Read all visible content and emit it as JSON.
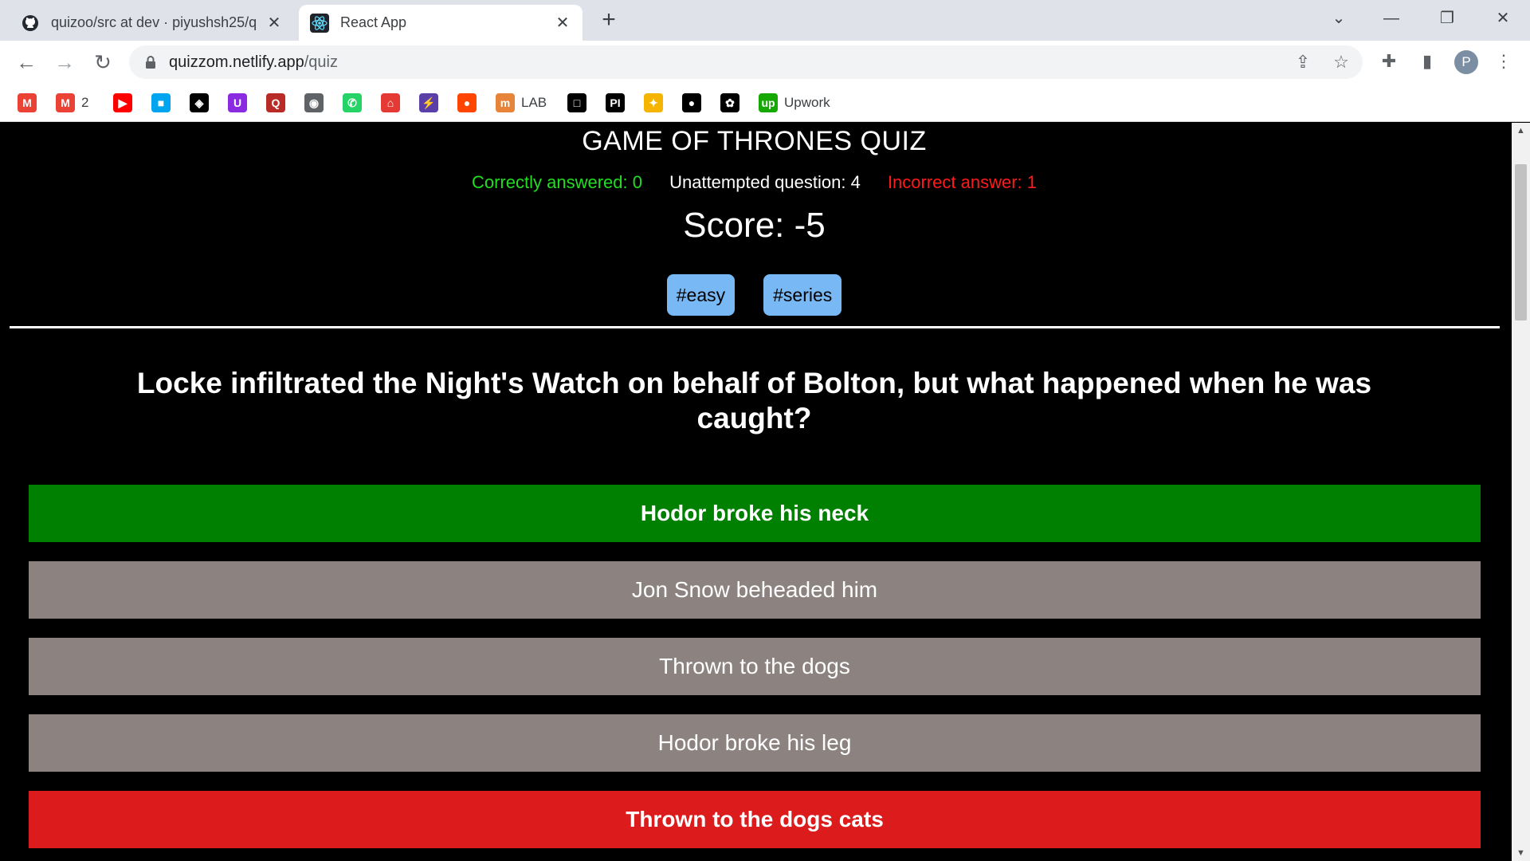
{
  "browser": {
    "tabs": [
      {
        "title": "quizoo/src at dev · piyushsh25/q",
        "icon": "github-icon",
        "active": false
      },
      {
        "title": "React App",
        "icon": "react-icon",
        "active": true
      }
    ],
    "url_host": "quizzom.netlify.app",
    "url_path": "/quiz",
    "profile_initial": "P",
    "bookmarks": [
      {
        "label": "",
        "icon": "gmail-icon",
        "color": "#ea4335",
        "glyph": "M"
      },
      {
        "label": "2",
        "icon": "gmail-icon",
        "color": "#ea4335",
        "glyph": "M"
      },
      {
        "label": "",
        "icon": "youtube-icon",
        "color": "#ff0000",
        "glyph": "▶"
      },
      {
        "label": "",
        "icon": "microsoft-icon",
        "color": "#00a4ef",
        "glyph": "■"
      },
      {
        "label": "",
        "icon": "codepen-icon",
        "color": "#000000",
        "glyph": "◈"
      },
      {
        "label": "",
        "icon": "bookmark-purple-icon",
        "color": "#8a2be2",
        "glyph": "U"
      },
      {
        "label": "",
        "icon": "quora-icon",
        "color": "#b92b27",
        "glyph": "Q"
      },
      {
        "label": "",
        "icon": "globe-icon",
        "color": "#5f6368",
        "glyph": "◉"
      },
      {
        "label": "",
        "icon": "whatsapp-icon",
        "color": "#25d366",
        "glyph": "✆"
      },
      {
        "label": "",
        "icon": "store-icon",
        "color": "#e53935",
        "glyph": "⌂"
      },
      {
        "label": "",
        "icon": "bolt-icon",
        "color": "#5b3fa8",
        "glyph": "⚡"
      },
      {
        "label": "",
        "icon": "reddit-icon",
        "color": "#ff4500",
        "glyph": "●"
      },
      {
        "label": "LAB",
        "icon": "lab-icon",
        "color": "#e8833a",
        "glyph": "m"
      },
      {
        "label": "",
        "icon": "square-icon",
        "color": "#000000",
        "glyph": "□"
      },
      {
        "label": "",
        "icon": "pycharm-icon",
        "color": "#000000",
        "glyph": "PI"
      },
      {
        "label": "",
        "icon": "runner-icon",
        "color": "#f4b400",
        "glyph": "✦"
      },
      {
        "label": "",
        "icon": "github-icon",
        "color": "#000000",
        "glyph": "●"
      },
      {
        "label": "",
        "icon": "openai-icon",
        "color": "#000000",
        "glyph": "✿"
      },
      {
        "label": "Upwork",
        "icon": "upwork-icon",
        "color": "#14a800",
        "glyph": "up"
      }
    ]
  },
  "quiz": {
    "title": "GAME OF THRONES QUIZ",
    "correct_label": "Correctly answered: 0",
    "unattempted_label": "Unattempted question: 4",
    "incorrect_label": "Incorrect answer: 1",
    "score_label": "Score: -5",
    "tags": [
      "#easy",
      "#series"
    ],
    "question": "Locke infiltrated the Night's Watch on behalf of Bolton, but what happened when he was caught?",
    "options": [
      {
        "text": "Hodor broke his neck",
        "state": "correct"
      },
      {
        "text": "Jon Snow beheaded him",
        "state": "neutral"
      },
      {
        "text": "Thrown to the dogs",
        "state": "neutral"
      },
      {
        "text": "Hodor broke his leg",
        "state": "neutral"
      },
      {
        "text": "Thrown to the dogs cats",
        "state": "wrong"
      }
    ],
    "colors": {
      "correct": "#008000",
      "neutral": "#8c8280",
      "wrong": "#dc1c1c",
      "tag": "#78b8f5"
    }
  }
}
